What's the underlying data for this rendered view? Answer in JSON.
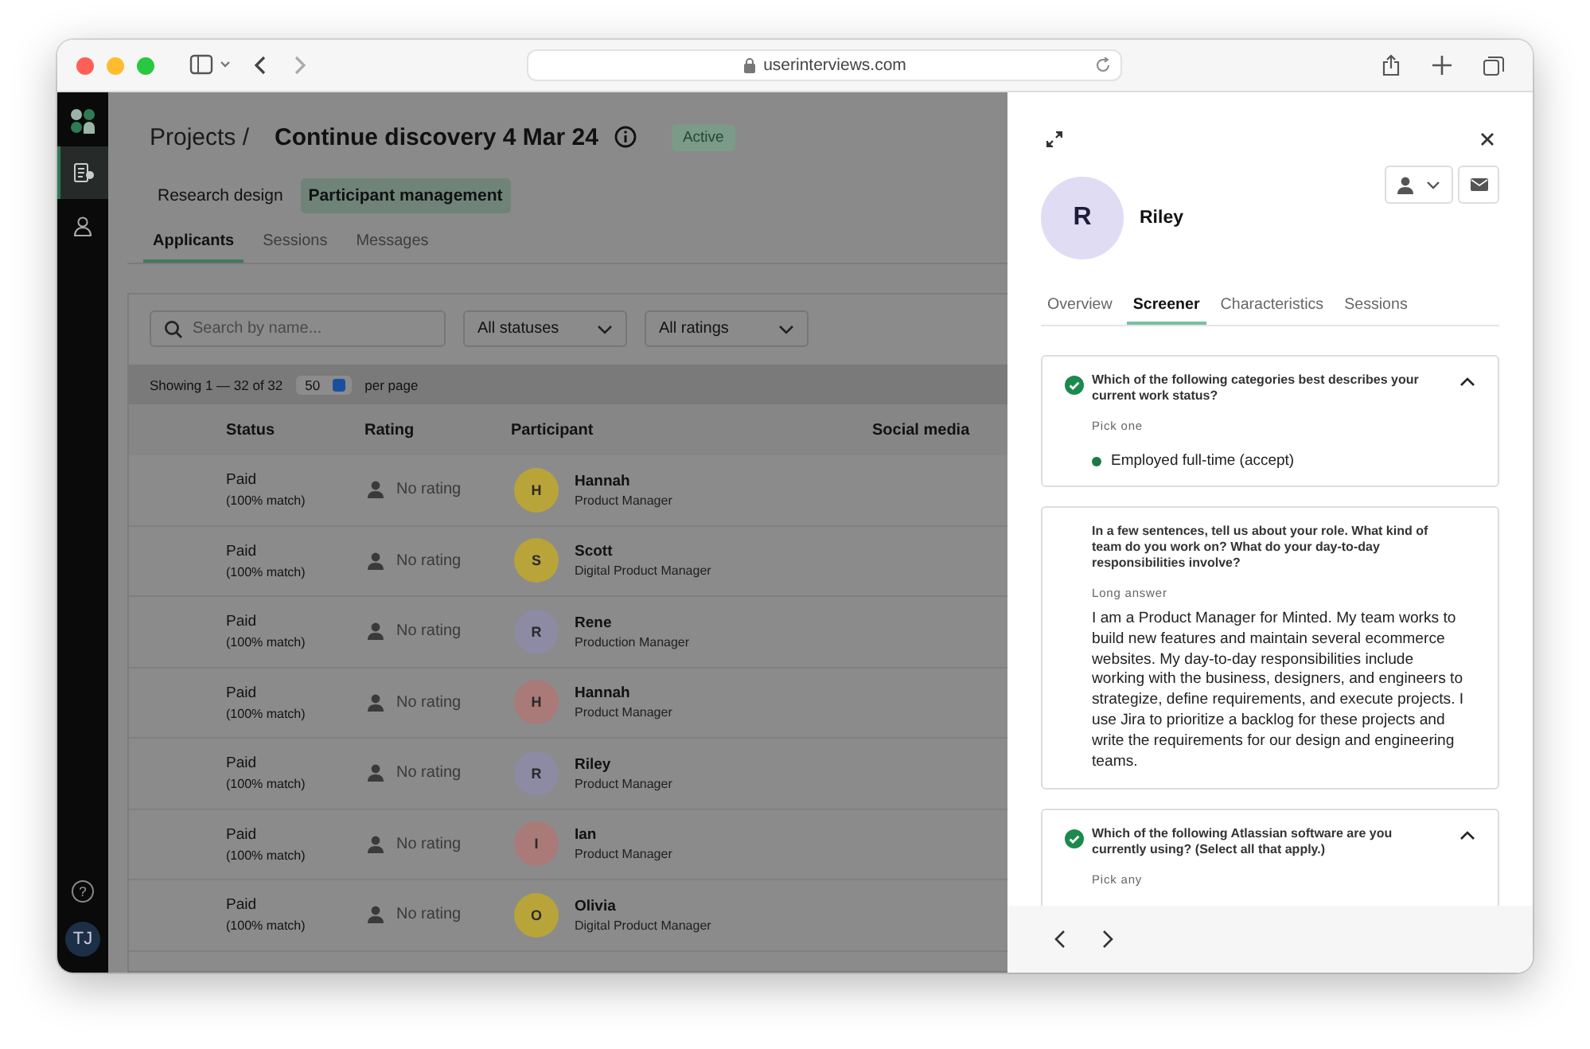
{
  "browser": {
    "url": "userinterviews.com"
  },
  "sidebar": {
    "items": [
      {
        "selected": true
      },
      {
        "selected": false
      }
    ],
    "help": "?",
    "user_initials": "TJ"
  },
  "project": {
    "breadcrumb": "Projects /",
    "title": "Continue discovery 4 Mar 24",
    "status": "Active"
  },
  "section_tabs": [
    {
      "label": "Research design",
      "selected": false
    },
    {
      "label": "Participant management",
      "selected": true
    }
  ],
  "sub_tabs": [
    {
      "label": "Applicants",
      "selected": true
    },
    {
      "label": "Sessions",
      "selected": false
    },
    {
      "label": "Messages",
      "selected": false
    }
  ],
  "filters": {
    "search": {
      "placeholder": "Search by name..."
    },
    "status": "All statuses",
    "rating": "All ratings"
  },
  "pagination": {
    "showing": "Showing 1 — 32 of 32",
    "per_page_value": "50",
    "per_page_label": "per page"
  },
  "table": {
    "columns": [
      "Status",
      "Rating",
      "Participant",
      "Social media"
    ],
    "rows": [
      {
        "status": "Paid",
        "match": "(100% match)",
        "rating": "No rating",
        "initial": "H",
        "name": "Hannah",
        "role": "Product Manager",
        "color": "#b9a43a"
      },
      {
        "status": "Paid",
        "match": "(100% match)",
        "rating": "No rating",
        "initial": "S",
        "name": "Scott",
        "role": "Digital Product Manager",
        "color": "#b9a43a"
      },
      {
        "status": "Paid",
        "match": "(100% match)",
        "rating": "No rating",
        "initial": "R",
        "name": "Rene",
        "role": "Production Manager",
        "color": "#8d8ba3"
      },
      {
        "status": "Paid",
        "match": "(100% match)",
        "rating": "No rating",
        "initial": "H",
        "name": "Hannah",
        "role": "Product Manager",
        "color": "#a97a77"
      },
      {
        "status": "Paid",
        "match": "(100% match)",
        "rating": "No rating",
        "initial": "R",
        "name": "Riley",
        "role": "Product Manager",
        "color": "#8d8ba3"
      },
      {
        "status": "Paid",
        "match": "(100% match)",
        "rating": "No rating",
        "initial": "I",
        "name": "Ian",
        "role": "Product Manager",
        "color": "#a97a77"
      },
      {
        "status": "Paid",
        "match": "(100% match)",
        "rating": "No rating",
        "initial": "O",
        "name": "Olivia",
        "role": "Digital Product Manager",
        "color": "#b9a43a"
      }
    ]
  },
  "panel": {
    "initial": "R",
    "name": "Riley",
    "tabs": [
      {
        "label": "Overview",
        "selected": false
      },
      {
        "label": "Screener",
        "selected": true
      },
      {
        "label": "Characteristics",
        "selected": false
      },
      {
        "label": "Sessions",
        "selected": false
      }
    ],
    "questions": [
      {
        "kind": "choice",
        "checked": true,
        "question": "Which of the following categories best describes your current work status?",
        "hint": "Pick one",
        "answers": [
          "Employed full-time (accept)"
        ]
      },
      {
        "kind": "long",
        "checked": false,
        "question": "In a few sentences, tell us about your role. What kind of team do you work on? What do your day-to-day responsibilities involve?",
        "hint": "Long answer",
        "answer": "I am a Product Manager for Minted. My team works to build new features and maintain several ecommerce websites. My day-to-day responsibilities include working with the business, designers, and engineers to strategize, define requirements, and execute projects. I use Jira to prioritize a backlog for these projects and write the requirements for our design and engineering teams."
      },
      {
        "kind": "choice",
        "checked": true,
        "question": "Which of the following Atlassian software are you currently using? (Select all that apply.)",
        "hint": "Pick any"
      }
    ]
  }
}
